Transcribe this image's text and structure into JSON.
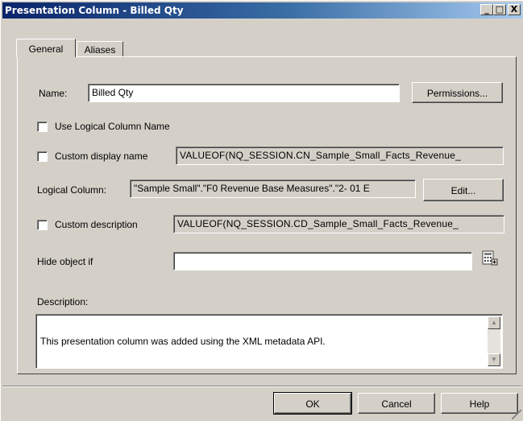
{
  "window": {
    "title": "Presentation Column - Billed Qty",
    "minimize": "_",
    "maximize": "□",
    "close": "X"
  },
  "tabs": [
    {
      "label": "General",
      "active": true
    },
    {
      "label": "Aliases",
      "active": false
    }
  ],
  "form": {
    "name_label": "Name:",
    "name_value": "Billed Qty",
    "permissions_label": "Permissions...",
    "use_logical_label": "Use Logical Column Name",
    "custom_display_label": "Custom display name",
    "custom_display_value": "VALUEOF(NQ_SESSION.CN_Sample_Small_Facts_Revenue_",
    "logical_column_label": "Logical Column:",
    "logical_column_value": "\"Sample Small\".\"F0 Revenue Base Measures\".\"2- 01 E",
    "edit_label": "Edit...",
    "custom_description_label": "Custom description",
    "custom_description_value": "VALUEOF(NQ_SESSION.CD_Sample_Small_Facts_Revenue_",
    "hide_object_label": "Hide object if",
    "hide_object_value": "",
    "description_label": "Description:",
    "description_value": "This presentation column was added using the XML metadata API."
  },
  "footer": {
    "ok_label": "OK",
    "cancel_label": "Cancel",
    "help_label": "Help"
  },
  "icons": {
    "expression_builder": "expression-builder-icon",
    "scroll_up": "▲",
    "scroll_down": "▼"
  }
}
